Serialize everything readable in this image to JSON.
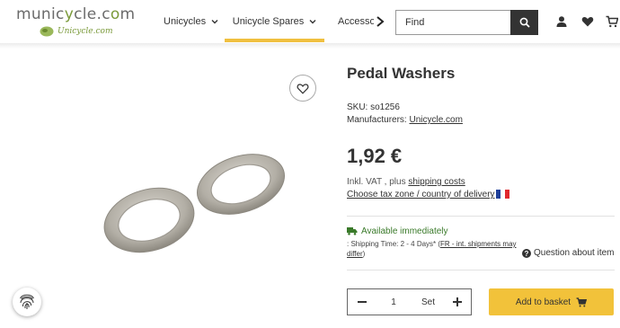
{
  "logo": {
    "main_prefix": "munic",
    "main_accent": "y",
    "main_suffix": "cle.c",
    "main_accent2": "o",
    "main_end": "m",
    "sub": "Unicycle.com"
  },
  "nav": {
    "items": [
      {
        "label": "Unicycles"
      },
      {
        "label": "Unicycle Spares"
      },
      {
        "label": "Accessories"
      }
    ]
  },
  "search": {
    "placeholder": "Find"
  },
  "product": {
    "title": "Pedal Washers",
    "sku_label": "SKU:",
    "sku_value": "so1256",
    "manufacturer_label": "Manufacturers:",
    "manufacturer_value": "Unicycle.com",
    "price": "1,92 €",
    "vat_text": "Inkl. VAT , plus ",
    "shipping_link": "shipping costs",
    "taxzone_link": "Choose tax zone / country of delivery",
    "availability": "Available immediately",
    "shipping_time_prefix": ": Shipping Time: 2 - 4 Days* (",
    "shipping_time_link": "FR - int. shipments may differ",
    "shipping_time_suffix": ")",
    "question_link": "Question about item"
  },
  "purchase": {
    "quantity": "1",
    "unit": "Set",
    "add_label": "Add to basket"
  },
  "colors": {
    "accent": "#f2c23a",
    "available": "#3a7a2a",
    "brand_green": "#7a9a3a"
  },
  "icons": {
    "search": "search-icon",
    "user": "user-icon",
    "wishlist": "heart-icon",
    "cart": "cart-icon",
    "fingerprint": "fingerprint-icon",
    "truck": "truck-icon",
    "question": "question-icon",
    "basket": "basket-icon"
  }
}
